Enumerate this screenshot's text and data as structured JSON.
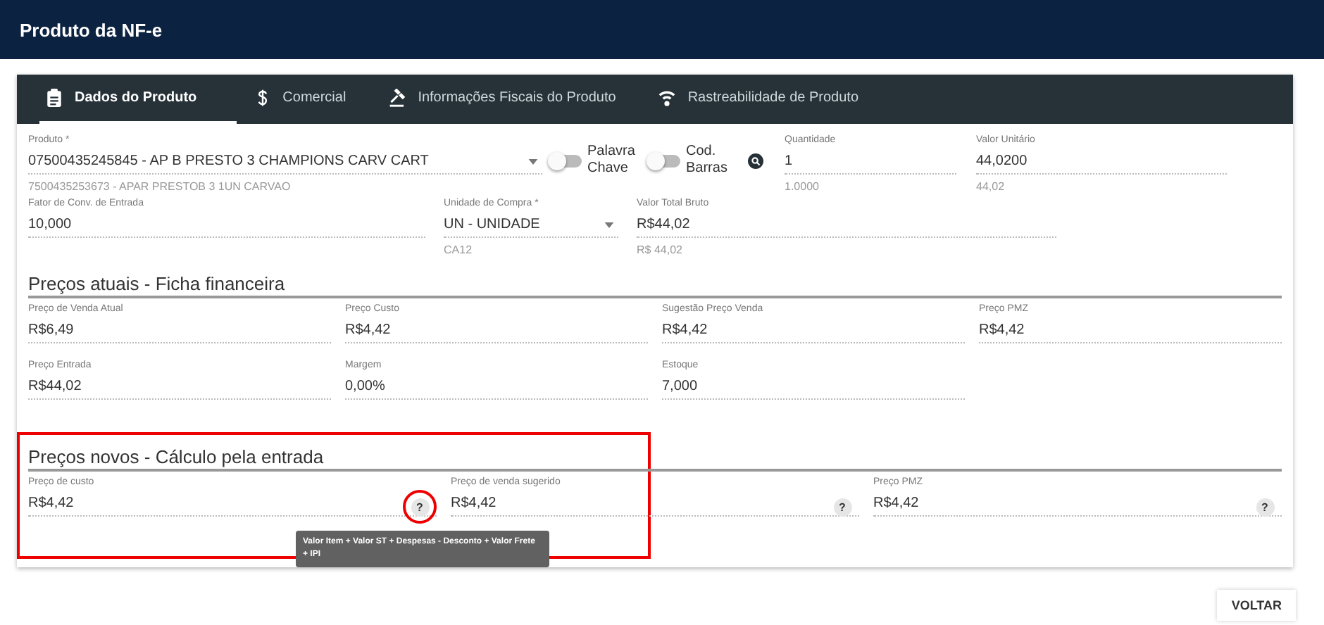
{
  "header": {
    "title": "Produto da NF-e"
  },
  "tabs": [
    {
      "label": "Dados do Produto",
      "kind": "clipboard",
      "selected": true
    },
    {
      "label": "Comercial",
      "kind": "dollar",
      "selected": false
    },
    {
      "label": "Informações Fiscais do Produto",
      "kind": "gavel",
      "selected": false
    },
    {
      "label": "Rastreabilidade de Produto",
      "kind": "signal",
      "selected": false
    }
  ],
  "product": {
    "label": "Produto *",
    "value": "07500435245845 - AP B PRESTO 3 CHAMPIONS CARV CART",
    "hint": "7500435253673 - APAR PRESTOB 3 1UN CARVAO"
  },
  "toggles": [
    {
      "label": "Palavra Chave",
      "on": false
    },
    {
      "label": "Cod. Barras",
      "on": false
    }
  ],
  "row1_fields": [
    {
      "label": "Quantidade",
      "value": "1",
      "hint": "1.0000"
    },
    {
      "label": "Valor Unitário",
      "value": "44,0200",
      "hint": "44,02"
    }
  ],
  "row2_fields": [
    {
      "kind": "text",
      "label": "Fator de Conv. de Entrada",
      "value": "10,000"
    },
    {
      "kind": "select",
      "label": "Unidade de Compra *",
      "value": "UN - UNIDADE",
      "hint": "CA12"
    },
    {
      "kind": "text",
      "label": "Valor Total Bruto",
      "value": "R$44,02",
      "hint": "R$ 44,02"
    }
  ],
  "current_prices": {
    "title": "Preços atuais - Ficha financeira",
    "fields": [
      {
        "label": "Preço de Venda Atual",
        "value": "R$6,49"
      },
      {
        "label": "Preço Custo",
        "value": "R$4,42"
      },
      {
        "label": "Sugestão Preço Venda",
        "value": "R$4,42"
      },
      {
        "label": "Preço PMZ",
        "value": "R$4,42"
      },
      {
        "label": "Preço Entrada",
        "value": "R$44,02"
      },
      {
        "label": "Margem",
        "value": "0,00%"
      },
      {
        "label": "Estoque",
        "value": "7,000"
      }
    ]
  },
  "new_prices": {
    "title": "Preços novos - Cálculo pela entrada",
    "highlighted": true,
    "fields": [
      {
        "label": "Preço de custo",
        "value": "R$4,42",
        "help": "?",
        "help_highlighted": true,
        "tooltip": "Valor Item + Valor ST + Despesas - Desconto + Valor Frete + IPI"
      },
      {
        "label": "Preço de venda sugerido",
        "value": "R$4,42",
        "help": "?",
        "help_highlighted": false
      },
      {
        "label": "Preço PMZ",
        "value": "R$4,42",
        "help": "?",
        "help_highlighted": false
      }
    ]
  },
  "buttons": [
    "VOLTAR"
  ]
}
